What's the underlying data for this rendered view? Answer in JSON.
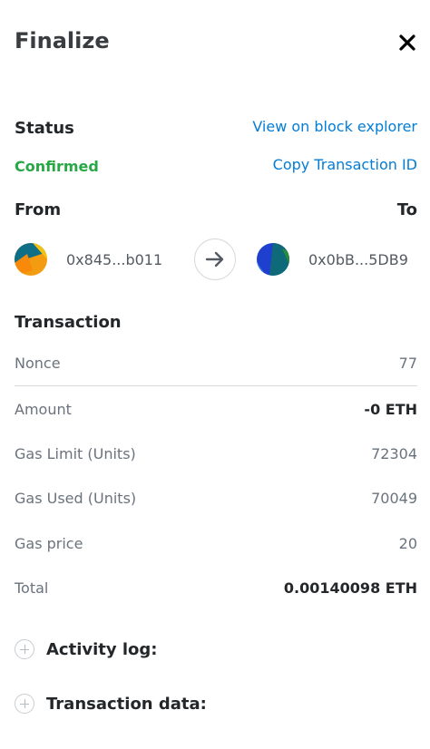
{
  "header": {
    "title": "Finalize",
    "close_icon": "close-icon"
  },
  "status": {
    "label": "Status",
    "value": "Confirmed",
    "view_explorer_link": "View on block explorer",
    "copy_tx_link": "Copy Transaction ID",
    "value_color": "#28a745",
    "link_color": "#037dd6"
  },
  "parties": {
    "from_label": "From",
    "to_label": "To",
    "from_address": "0x845...b011",
    "to_address": "0x0bB...5DB9",
    "arrow_icon": "arrow-right-icon"
  },
  "transaction": {
    "heading": "Transaction",
    "rows": [
      {
        "label": "Nonce",
        "value": "77"
      },
      {
        "label": "Amount",
        "value": "-0 ETH"
      },
      {
        "label": "Gas Limit (Units)",
        "value": "72304"
      },
      {
        "label": "Gas Used (Units)",
        "value": "70049"
      },
      {
        "label": "Gas price",
        "value": "20"
      },
      {
        "label": "Total",
        "value": "0.00140098 ETH"
      }
    ]
  },
  "expanders": {
    "activity_log": "Activity log:",
    "transaction_data": "Transaction data:",
    "icon": "plus-circle-icon"
  }
}
